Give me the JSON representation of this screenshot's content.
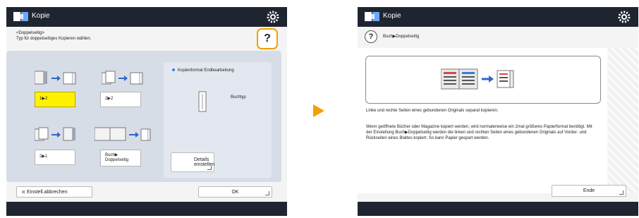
{
  "left_screen": {
    "title": "Kopie",
    "subtitle": "<Doppelseitig>",
    "instruction": "Typ für doppelseitiges Kopieren wählen.",
    "options": [
      {
        "label": "1▶2",
        "selected": true
      },
      {
        "label": "2▶2",
        "selected": false
      },
      {
        "label": "2▶1",
        "selected": false
      },
      {
        "label": "Buch▶ Doppelseitig",
        "selected": false
      }
    ],
    "info_header": "Kopienformat Endbearbeitung",
    "book_label": "Buchtyp",
    "details_button": "Details einstellen",
    "cancel_button": "Einstell.abbrechen",
    "ok_button": "OK",
    "help_icon": "question-icon",
    "help_highlight_color": "#f3a000",
    "selected_color": "#fff200"
  },
  "right_screen": {
    "title": "Kopie",
    "help_label": "Buch▶Doppelseitig",
    "description": "Linke und rechte Seiten eines gebundenen Originals separat kopieren.",
    "detail": "Wenn geöffnete Bücher oder Magazine kopiert werden, wird normalerweise ein 2mal größeres Papierformat benötigt. Mit der Einstellung Buch▶Doppelseitig werden die linken und rechten Seiten eines gebundenen Originals auf Vorder- und Rückseiten eines Blattes kopiert. So kann Papier gespart werden.",
    "end_button": "Ende"
  },
  "arrow_color": "#f5a000"
}
